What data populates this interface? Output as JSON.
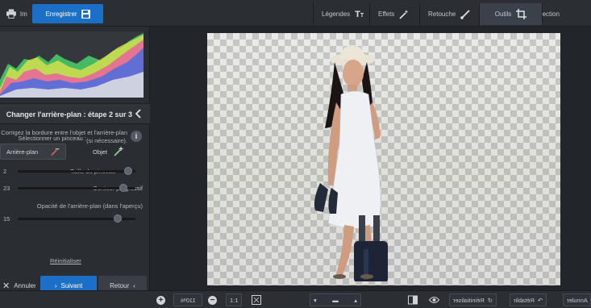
{
  "toolbar": {
    "save_label": "Enregistrer",
    "print_label": "Imprimer"
  },
  "right_tabs": [
    {
      "label": "Légendes",
      "icon": "text-icon"
    },
    {
      "label": "Effets",
      "icon": "magic-wand-icon"
    },
    {
      "label": "Retouche",
      "icon": "brush-icon"
    },
    {
      "label": "Outils",
      "icon": "crop-icon",
      "active": true
    },
    {
      "label": "Sélection",
      "icon": "selection-icon"
    }
  ],
  "panel": {
    "step_title": "Changer l'arrière-plan : étape 2 sur 3",
    "hint": "Corrigez la bordure entre l'objet et l'arrière-plan\n(si nécessaire).",
    "brush_label": "Sélectionner un pinceau :",
    "brush_objet": "Objet",
    "brush_arriere": "Arrière-plan",
    "sliders": [
      {
        "label": "Taille du pinceau",
        "value": "2",
        "level": 0.06
      },
      {
        "label": "Contour progressif",
        "value": "23",
        "level": 0.1
      },
      {
        "label": "Opacité de l'arrière-plan (dans l'aperçu)",
        "value": "15",
        "level": 0.15
      }
    ],
    "reset_label": "Réinitialiser",
    "back_label": "Retour",
    "next_label": "Suivant",
    "cancel_label": "Annuler"
  },
  "bottom": {
    "zoom": "110%",
    "ratio_label": "1:1",
    "reset_label": "Réinitialiser",
    "redo_label": "Rétablir",
    "undo_label": "Annuler"
  },
  "colors": {
    "accent": "#1b6fc7",
    "panel": "#2a2d32",
    "toolbar": "#2b2e33"
  }
}
